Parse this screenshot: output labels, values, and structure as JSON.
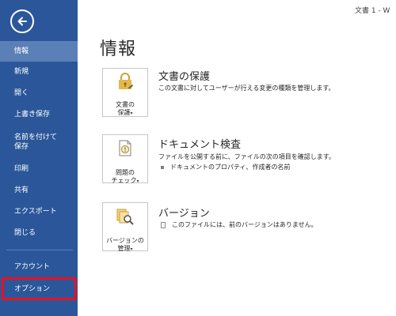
{
  "window": {
    "title": "文書 1 - W"
  },
  "sidebar": {
    "items": [
      {
        "label": "情報"
      },
      {
        "label": "新規"
      },
      {
        "label": "開く"
      },
      {
        "label": "上書き保存"
      },
      {
        "label": "名前を付けて\n保存"
      },
      {
        "label": "印刷"
      },
      {
        "label": "共有"
      },
      {
        "label": "エクスポート"
      },
      {
        "label": "閉じる"
      },
      {
        "label": "アカウント"
      },
      {
        "label": "オプション"
      }
    ],
    "active_index": 0,
    "highlighted_index": 10
  },
  "main": {
    "title": "情報",
    "sections": [
      {
        "tile_label": "文書の\n保護",
        "title": "文書の保護",
        "description": "この文書に対してユーザーが行える変更の種類を管理します。",
        "icon": "lock-icon"
      },
      {
        "tile_label": "問題の\nチェック",
        "title": "ドキュメント検査",
        "description": "ファイルを公開する前に、ファイルの次の項目を確認します。",
        "bullets": [
          "ドキュメントのプロパティ、作成者の名前"
        ],
        "icon": "inspect-document-icon"
      },
      {
        "tile_label": "バージョンの\n管理",
        "title": "バージョン",
        "description": "このファイルには、前のバージョンはありません。",
        "icon": "versions-icon"
      }
    ],
    "dropdown_caret": "▾"
  },
  "colors": {
    "sidebar_bg": "#2b579a",
    "sidebar_active": "#5b80b8",
    "highlight_border": "#e81123"
  }
}
